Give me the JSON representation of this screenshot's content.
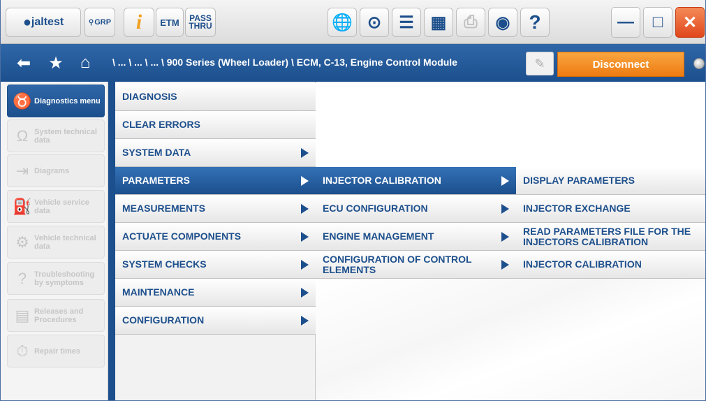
{
  "toolbar": {
    "logo": "jaltest",
    "grp": "GRP",
    "info": "i",
    "etm": "ETM",
    "pass_thru_1": "PASS",
    "pass_thru_2": "THRU",
    "icons": [
      "globe-icon",
      "connector-icon",
      "list-icon",
      "calculator-icon",
      "print-icon",
      "camera-icon",
      "help-icon"
    ]
  },
  "window": {
    "minimize": "—",
    "maximize": "□",
    "close": "✕"
  },
  "nav": {
    "breadcrumb": "\\ ... \\ ... \\ ... \\ 900 Series (Wheel Loader) \\ ECM, C-13, Engine Control Module",
    "disconnect_label": "Disconnect"
  },
  "sidebar": {
    "items": [
      {
        "label": "Diagnostics menu",
        "icon": "stethoscope-icon",
        "active": true
      },
      {
        "label": "System technical data",
        "icon": "omega-icon",
        "active": false
      },
      {
        "label": "Diagrams",
        "icon": "diagram-icon",
        "active": false
      },
      {
        "label": "Vehicle service data",
        "icon": "oil-can-icon",
        "active": false
      },
      {
        "label": "Vehicle technical data",
        "icon": "wrench-gear-icon",
        "active": false
      },
      {
        "label": "Troubleshooting by symptoms",
        "icon": "troubleshoot-icon",
        "active": false
      },
      {
        "label": "Releases and Procedures",
        "icon": "procedures-icon",
        "active": false
      },
      {
        "label": "Repair times",
        "icon": "stopwatch-icon",
        "active": false
      }
    ]
  },
  "menu1": [
    {
      "label": "DIAGNOSIS",
      "arrow": false,
      "active": false
    },
    {
      "label": "CLEAR ERRORS",
      "arrow": false,
      "active": false
    },
    {
      "label": "SYSTEM DATA",
      "arrow": true,
      "active": false
    },
    {
      "label": "PARAMETERS",
      "arrow": true,
      "active": true
    },
    {
      "label": "MEASUREMENTS",
      "arrow": true,
      "active": false
    },
    {
      "label": "ACTUATE COMPONENTS",
      "arrow": true,
      "active": false
    },
    {
      "label": "SYSTEM CHECKS",
      "arrow": true,
      "active": false
    },
    {
      "label": "MAINTENANCE",
      "arrow": true,
      "active": false
    },
    {
      "label": "CONFIGURATION",
      "arrow": true,
      "active": false
    }
  ],
  "menu2": [
    {
      "label": "INJECTOR CALIBRATION",
      "arrow": true,
      "active": true
    },
    {
      "label": "ECU CONFIGURATION",
      "arrow": true,
      "active": false
    },
    {
      "label": "ENGINE MANAGEMENT",
      "arrow": true,
      "active": false
    },
    {
      "label": "CONFIGURATION OF CONTROL ELEMENTS",
      "arrow": true,
      "active": false
    }
  ],
  "menu3": [
    {
      "label": "DISPLAY PARAMETERS"
    },
    {
      "label": "INJECTOR EXCHANGE"
    },
    {
      "label": "READ PARAMETERS FILE FOR THE INJECTORS CALIBRATION"
    },
    {
      "label": "INJECTOR CALIBRATION"
    }
  ]
}
